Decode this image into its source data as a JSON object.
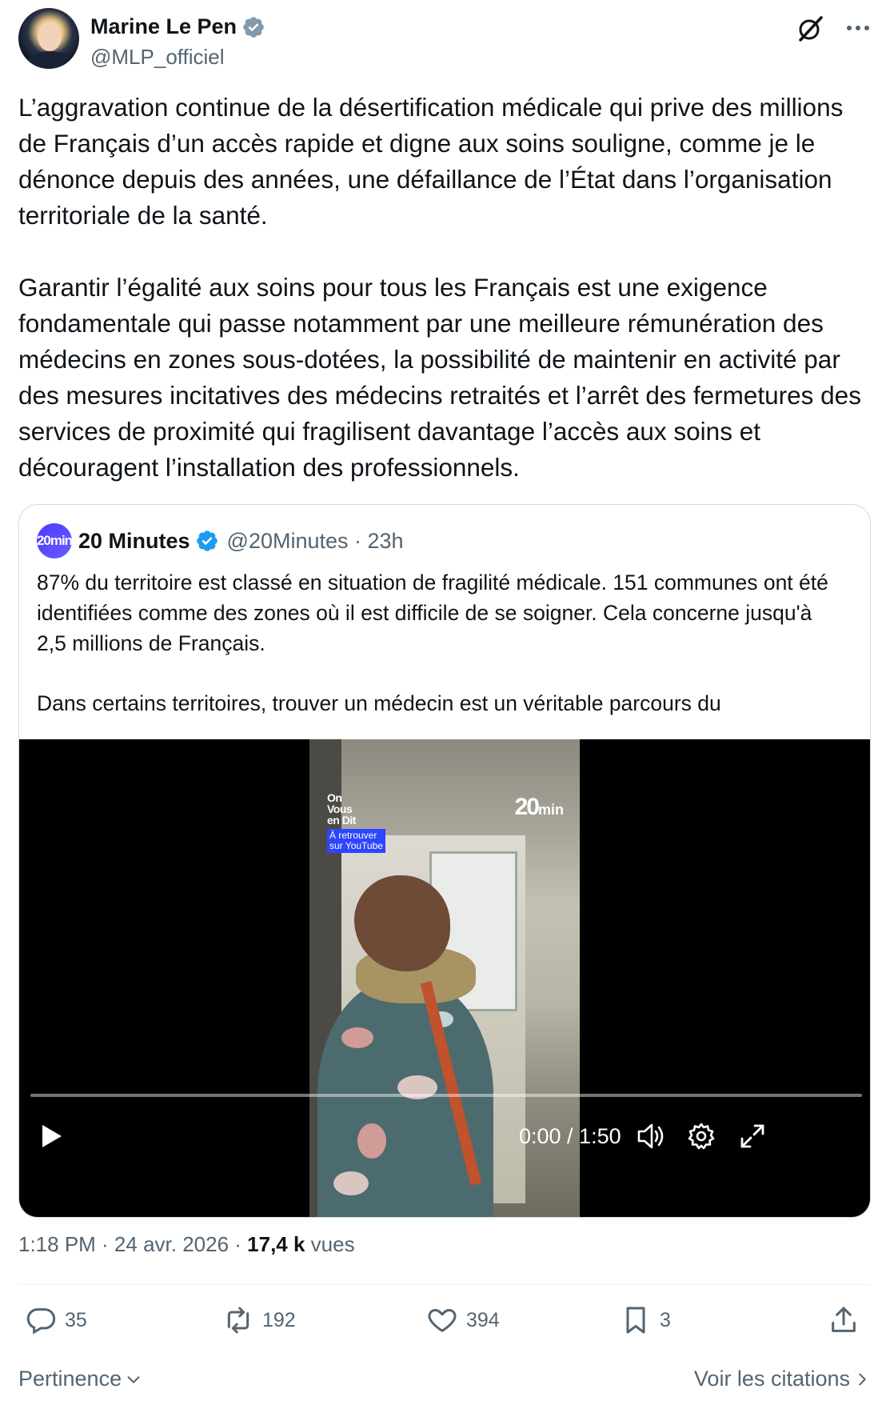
{
  "author": {
    "name": "Marine Le Pen",
    "handle": "@MLP_officiel",
    "verified": true
  },
  "tweet": {
    "paragraphs": [
      "L’aggravation continue de la désertification médicale qui prive des millions de Français d’un accès rapide et digne aux soins souligne, comme je le dénonce depuis des années, une défaillance de l’État dans l’organisation territoriale de la santé.",
      "Garantir l’égalité aux soins pour tous les Français est une exigence fondamentale qui passe notamment par une meilleure rémunération des médecins en zones sous-dotées, la possibilité de maintenir en activité par des mesures incitatives des médecins retraités et l’arrêt des fermetures des services de proximité qui fragilisent davantage l’accès aux soins et découragent l’installation des professionnels."
    ]
  },
  "quote": {
    "logo_text": "20min",
    "name": "20 Minutes",
    "handle": "@20Minutes · 23h",
    "paragraphs": [
      "87% du territoire est classé en situation de fragilité médicale. 151 communes ont été identifiées comme des zones où il est difficile de se soigner. Cela concerne jusqu'à 2,5 millions de Français.",
      "Dans certains territoires, trouver un médecin est un véritable parcours du"
    ],
    "video": {
      "overlay_badge": "On\nVous\nen Dit",
      "overlay_youtube": "À retrouver\nsur YouTube",
      "overlay_logo": "20",
      "overlay_logo_suffix": "min",
      "time": "0:00 / 1:50",
      "progress": 0.0
    }
  },
  "meta": {
    "time": "1:18 PM · 24 avr. 2026 · ",
    "views_count": "17,4 k",
    "views_label": " vues"
  },
  "actions": {
    "replies": "35",
    "reposts": "192",
    "likes": "394",
    "bookmarks": "3"
  },
  "footer": {
    "sort_label": "Pertinence",
    "quotes_link": "Voir les citations"
  },
  "colors": {
    "text": "#0f1419",
    "secondary": "#536471",
    "verified": "#829aab",
    "quote_verified": "#1d9bf0",
    "border": "#cfd9de"
  }
}
